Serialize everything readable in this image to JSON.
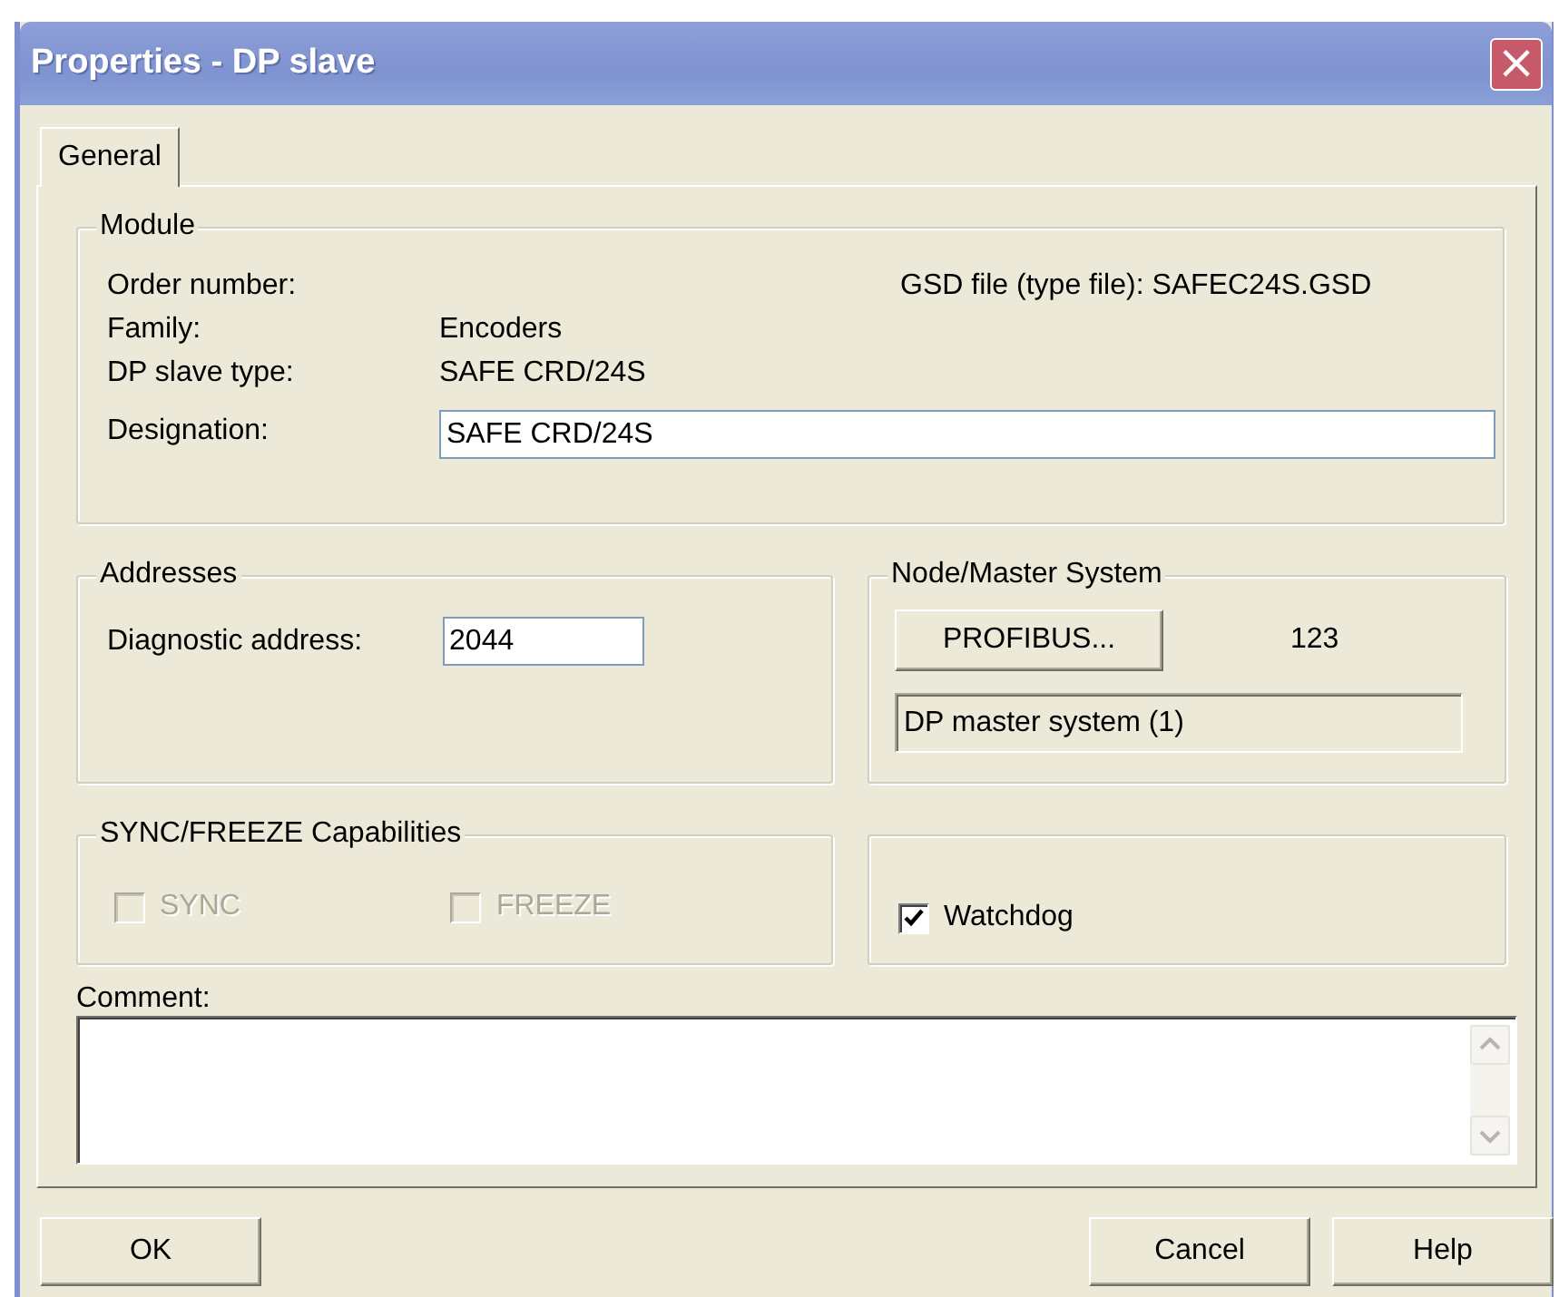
{
  "window": {
    "title": "Properties - DP slave",
    "close": "×"
  },
  "tabs": [
    {
      "label": "General",
      "selected": true
    }
  ],
  "module": {
    "legend": "Module",
    "order_number_label": "Order number:",
    "gsd_file": "GSD file (type file): SAFEC24S.GSD",
    "family_label": "Family:",
    "family_value": "Encoders",
    "type_label": "DP slave type:",
    "type_value": "SAFE CRD/24S",
    "designation_label": "Designation:",
    "designation_value": "SAFE CRD/24S"
  },
  "addresses": {
    "legend": "Addresses",
    "diagnostic_label": "Diagnostic address:",
    "diagnostic_value": "2044"
  },
  "node_master": {
    "legend": "Node/Master System",
    "button": "PROFIBUS...",
    "node_number": "123",
    "master_system": "DP master system (1)"
  },
  "sync_freeze": {
    "legend": "SYNC/FREEZE Capabilities",
    "options": [
      {
        "label": "SYNC",
        "checked": false,
        "disabled": true
      },
      {
        "label": "FREEZE",
        "checked": false,
        "disabled": true
      }
    ]
  },
  "watchdog": {
    "label": "Watchdog",
    "checked": true,
    "disabled": false
  },
  "comment": {
    "label": "Comment:"
  },
  "buttons": [
    {
      "label": "OK",
      "kind": "left"
    },
    {
      "label": "Cancel",
      "kind": "right"
    },
    {
      "label": "Help",
      "kind": "right"
    }
  ]
}
